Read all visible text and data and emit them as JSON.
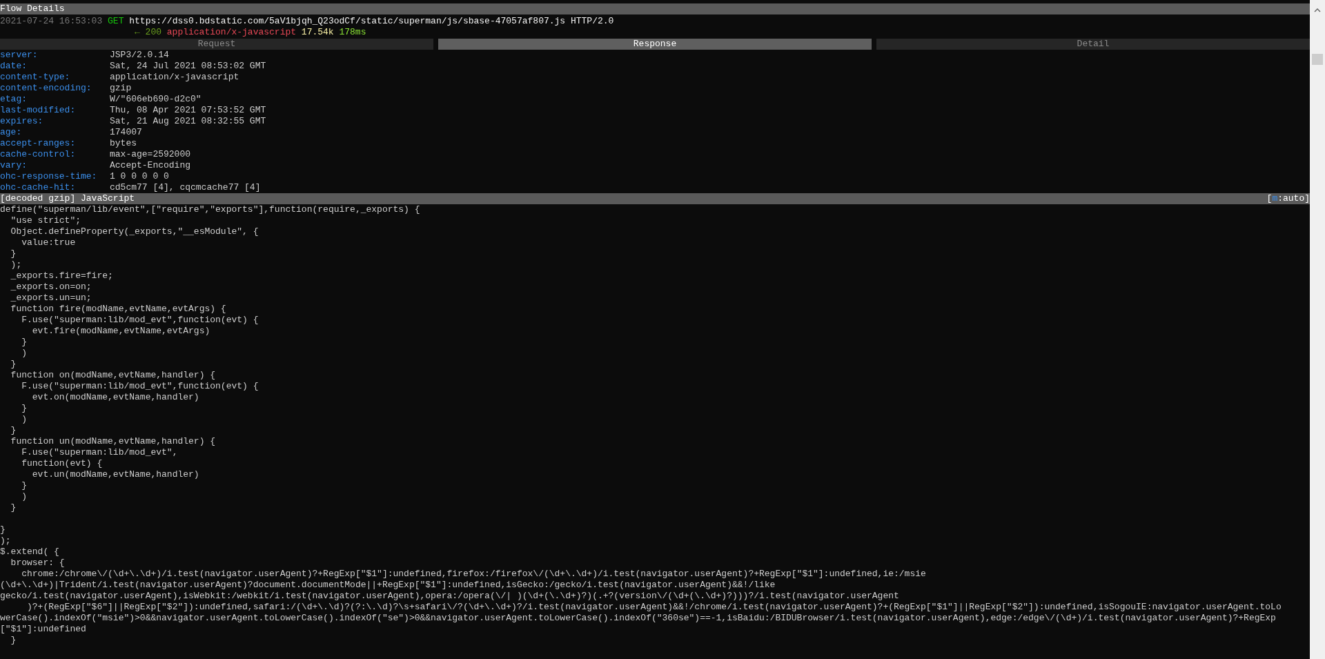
{
  "title": "Flow Details",
  "request_line": {
    "timestamp": "2021-07-24 16:53:03",
    "method": "GET",
    "url": "https://dss0.bdstatic.com/5aV1bjqh_Q23odCf/static/superman/js/sbase-47057af807.js",
    "http_version": "HTTP/2.0"
  },
  "response_line": {
    "arrow": "←",
    "status": "200",
    "content_type": "application/x-javascript",
    "size": "17.54k",
    "duration": "178ms"
  },
  "tabs": [
    {
      "label": "Request",
      "selected": false
    },
    {
      "label": "Response",
      "selected": true
    },
    {
      "label": "Detail",
      "selected": false
    }
  ],
  "headers": [
    {
      "name": "server:",
      "value": "JSP3/2.0.14"
    },
    {
      "name": "date:",
      "value": "Sat, 24 Jul 2021 08:53:02 GMT"
    },
    {
      "name": "content-type:",
      "value": "application/x-javascript"
    },
    {
      "name": "content-encoding:",
      "value": "gzip"
    },
    {
      "name": "etag:",
      "value": "W/\"606eb690-d2c0\""
    },
    {
      "name": "last-modified:",
      "value": "Thu, 08 Apr 2021 07:53:52 GMT"
    },
    {
      "name": "expires:",
      "value": "Sat, 21 Aug 2021 08:32:55 GMT"
    },
    {
      "name": "age:",
      "value": "174007"
    },
    {
      "name": "accept-ranges:",
      "value": "bytes"
    },
    {
      "name": "cache-control:",
      "value": "max-age=2592000"
    },
    {
      "name": "vary:",
      "value": "Accept-Encoding"
    },
    {
      "name": "ohc-response-time:",
      "value": "1 0 0 0 0 0"
    },
    {
      "name": "ohc-cache-hit:",
      "value": "cd5cm77 [4], cqcmcache77 [4]"
    }
  ],
  "body_bar": {
    "label": "[decoded gzip] JavaScript",
    "mode_prefix": "[",
    "mode_key": "m",
    "mode_suffix": ":auto]"
  },
  "code_blocks": [
    [
      "define(\"superman/lib/event\",[\"require\",\"exports\"],function(require,_exports) {",
      "  \"use strict\";",
      "  Object.defineProperty(_exports,\"__esModule\", {",
      "    value:true",
      "  }",
      "  );",
      "  _exports.fire=fire;",
      "  _exports.on=on;",
      "  _exports.un=un;",
      "  function fire(modName,evtName,evtArgs) {",
      "    F.use(\"superman:lib/mod_evt\",function(evt) {",
      "      evt.fire(modName,evtName,evtArgs)",
      "    }",
      "    )",
      "  }",
      "  function on(modName,evtName,handler) {",
      "    F.use(\"superman:lib/mod_evt\",function(evt) {",
      "      evt.on(modName,evtName,handler)",
      "    }",
      "    )",
      "  }",
      "  function un(modName,evtName,handler) {",
      "    F.use(\"superman:lib/mod_evt\",",
      "    function(evt) {",
      "      evt.un(modName,evtName,handler)",
      "    }",
      "    )",
      "  }"
    ],
    [
      "}",
      ");",
      "$.extend( {",
      "  browser: {",
      "    chrome:/chrome\\/(\\d+\\.\\d+)/i.test(navigator.userAgent)?+RegExp[\"$1\"]:undefined,firefox:/firefox\\/(\\d+\\.\\d+)/i.test(navigator.userAgent)?+RegExp[\"$1\"]:undefined,ie:/msie",
      "(\\d+\\.\\d+)|Trident/i.test(navigator.userAgent)?document.documentMode||+RegExp[\"$1\"]:undefined,isGecko:/gecko/i.test(navigator.userAgent)&&!/like",
      "gecko/i.test(navigator.userAgent),isWebkit:/webkit/i.test(navigator.userAgent),opera:/opera(\\/| )(\\d+(\\.\\d+)?)(.+?(version\\/(\\d+(\\.\\d+)?)))?/i.test(navigator.userAgent",
      "     )?+(RegExp[\"$6\"]||RegExp[\"$2\"]):undefined,safari:/(\\d+\\.\\d)?(?:\\.\\d)?\\s+safari\\/?(\\d+\\.\\d+)?/i.test(navigator.userAgent)&&!/chrome/i.test(navigator.userAgent)?+(RegExp[\"$1\"]||RegExp[\"$2\"]):undefined,isSogouIE:navigator.userAgent.toLo",
      "werCase().indexOf(\"msie\")>0&&navigator.userAgent.toLowerCase().indexOf(\"se\")>0&&navigator.userAgent.toLowerCase().indexOf(\"360se\")==-1,isBaidu:/BIDUBrowser/i.test(navigator.userAgent),edge:/edge\\/(\\d+)/i.test(navigator.userAgent)?+RegExp",
      "[\"$1\"]:undefined",
      "  }"
    ]
  ]
}
